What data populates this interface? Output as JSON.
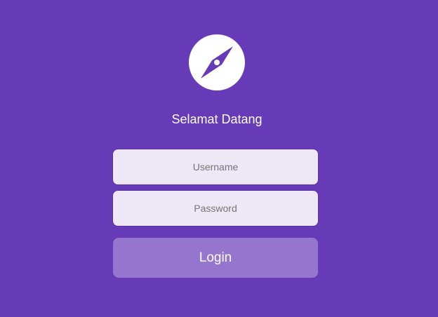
{
  "logo": {
    "icon": "compass-icon",
    "background_color": "#ffffff",
    "icon_color": "#673ab7"
  },
  "title": "Selamat Datang",
  "form": {
    "username_placeholder": "Username",
    "username_value": "",
    "password_placeholder": "Password",
    "password_value": "",
    "login_label": "Login"
  },
  "colors": {
    "background": "#673ab7",
    "input_background": "#ede7f6",
    "button_background": "#9575cd",
    "text": "#ffffff"
  }
}
